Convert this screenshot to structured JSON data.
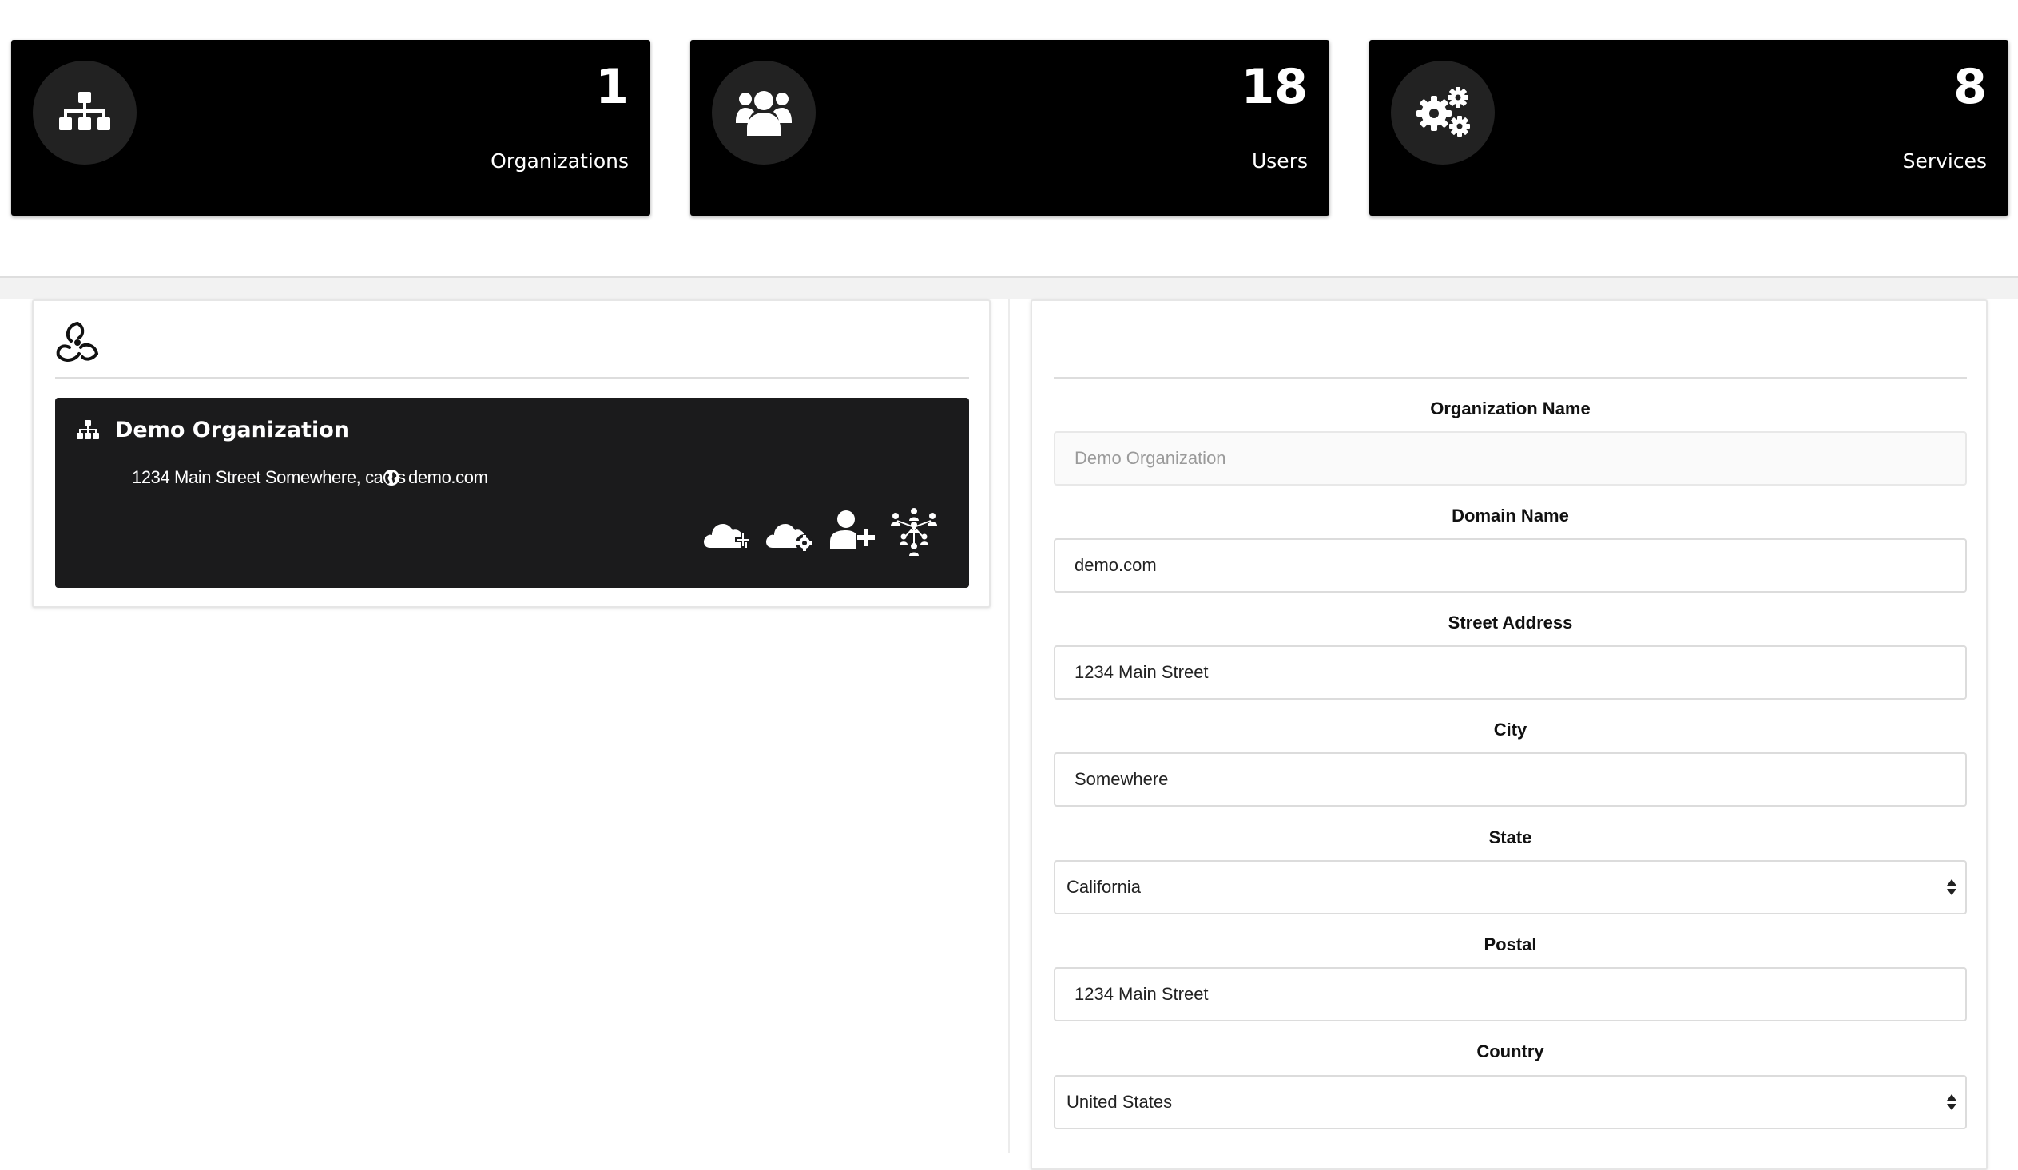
{
  "stats": [
    {
      "icon": "sitemap-icon",
      "value": "1",
      "label": "Organizations"
    },
    {
      "icon": "users-icon",
      "value": "18",
      "label": "Users"
    },
    {
      "icon": "gears-icon",
      "value": "8",
      "label": "Services"
    }
  ],
  "org_list": {
    "logo_icon": "triskele-logo-icon",
    "org": {
      "name": "Demo Organization",
      "address": "1234 Main Street Somewhere, ca us",
      "domain": "demo.com",
      "actions": [
        {
          "icon": "cloud-add-icon"
        },
        {
          "icon": "cloud-settings-icon"
        },
        {
          "icon": "user-add-icon"
        },
        {
          "icon": "org-network-icon"
        }
      ]
    }
  },
  "form": {
    "org_name": {
      "label": "Organization Name",
      "placeholder": "Demo Organization"
    },
    "domain": {
      "label": "Domain Name",
      "value": "demo.com"
    },
    "street": {
      "label": "Street Address",
      "value": "1234 Main Street"
    },
    "city": {
      "label": "City",
      "value": "Somewhere"
    },
    "state": {
      "label": "State",
      "value": "California"
    },
    "postal": {
      "label": "Postal",
      "value": "1234 Main Street"
    },
    "country": {
      "label": "Country",
      "value": "United States"
    }
  },
  "colors": {
    "card_bg": "#000000",
    "icon_circle": "#222222",
    "org_card_bg": "#1b1b1c",
    "page_bg": "#ffffff"
  }
}
